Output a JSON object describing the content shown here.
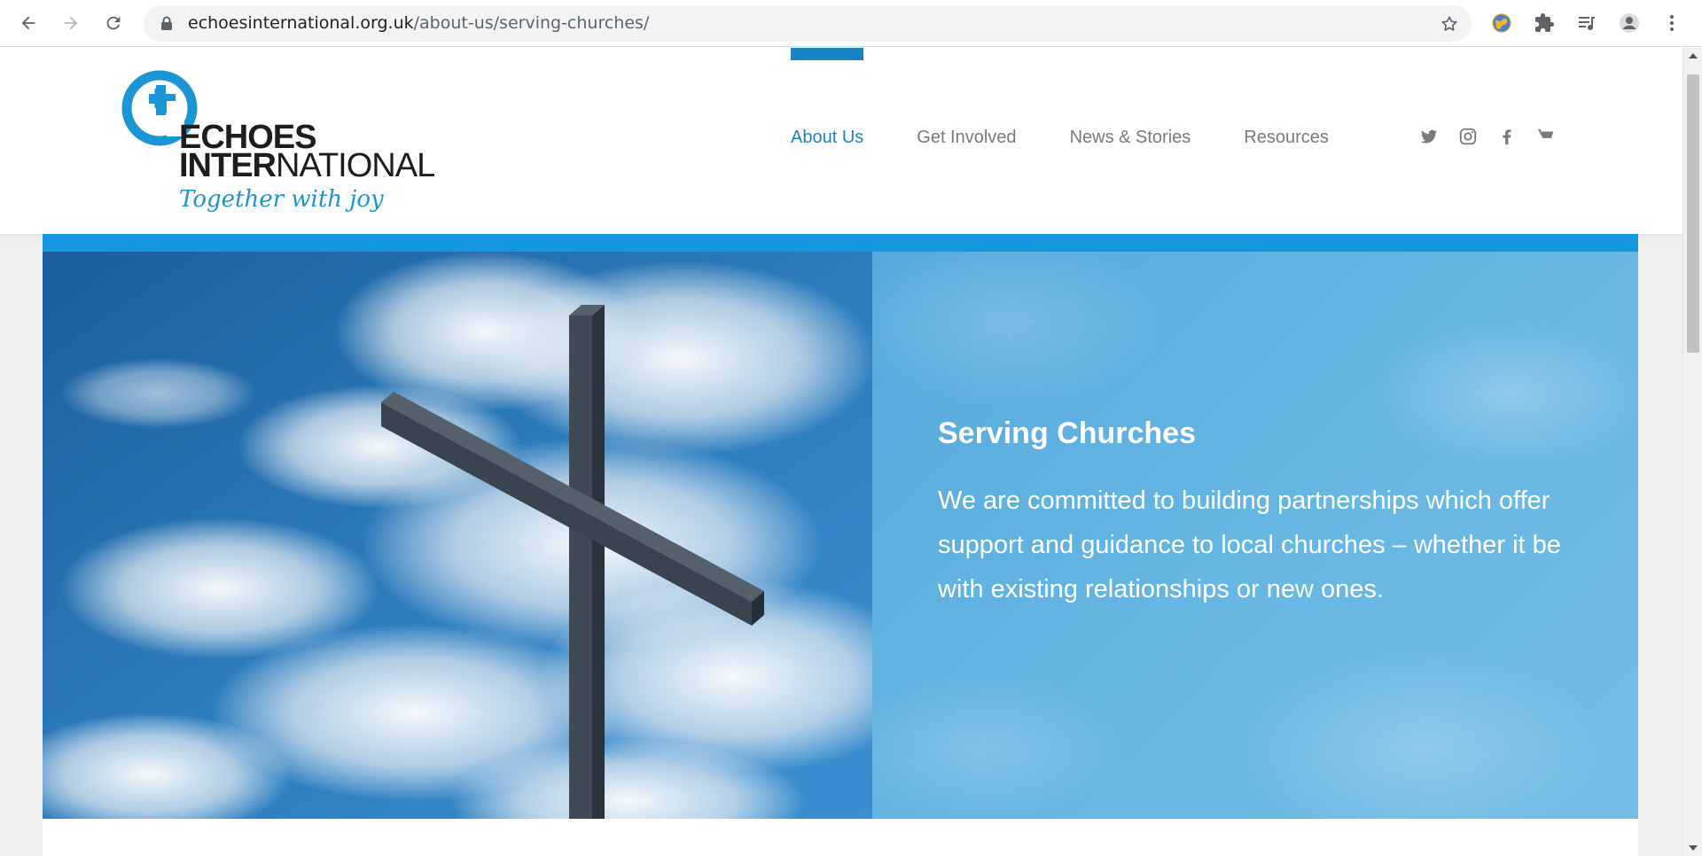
{
  "browser": {
    "url_domain": "echoesinternational.org.uk",
    "url_path": "/about-us/serving-churches/",
    "icons": {
      "back": "back-arrow-icon",
      "forward": "forward-arrow-icon",
      "reload": "reload-icon",
      "lock": "lock-icon",
      "bookmark": "star-icon",
      "extension_globe": "globe-extension-icon",
      "extensions": "puzzle-icon",
      "media": "media-queue-icon",
      "profile": "profile-icon",
      "menu": "kebab-menu-icon"
    }
  },
  "site": {
    "logo": {
      "line1": "ECHOES",
      "line2_bold": "INTER",
      "line2_light": "NATIONAL",
      "tagline": "Together with joy"
    },
    "nav": [
      {
        "label": "About Us",
        "active": true
      },
      {
        "label": "Get Involved",
        "active": false
      },
      {
        "label": "News & Stories",
        "active": false
      },
      {
        "label": "Resources",
        "active": false
      }
    ],
    "social": [
      "twitter-icon",
      "instagram-icon",
      "facebook-icon",
      "cart-icon"
    ]
  },
  "hero": {
    "title": "Serving Churches",
    "text": "We are committed to building partnerships which offer support and guidance to local churches – whether it be with existing relationships or new ones."
  },
  "colors": {
    "accent": "#1a82c6",
    "band": "#1597e0",
    "nav_text": "#7a7a7a",
    "hero_panel": "#66b6e3"
  }
}
